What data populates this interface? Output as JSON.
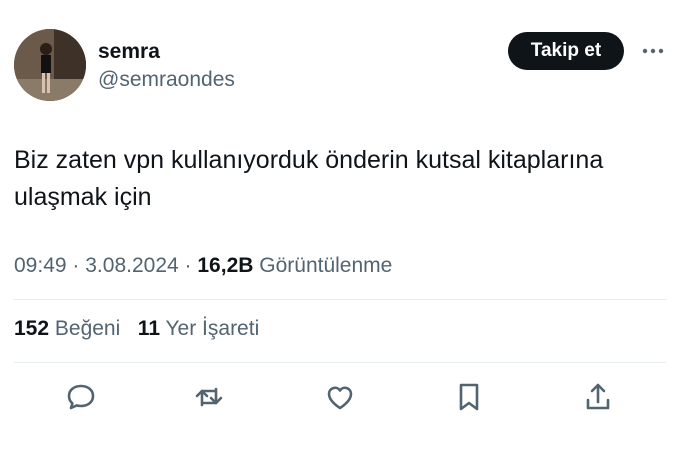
{
  "user": {
    "display_name": "semra",
    "handle": "@semraondes"
  },
  "header": {
    "follow_label": "Takip et",
    "more_icon": "more-horizontal-icon"
  },
  "tweet": {
    "text": "Biz zaten vpn kullanıyorduk önderin kutsal kitaplarına ulaşmak için",
    "time": "09:49",
    "separator": "·",
    "date": "3.08.2024",
    "views_count": "16,2B",
    "views_label": "Görüntülenme"
  },
  "stats": {
    "likes_count": "152",
    "likes_label": "Beğeni",
    "bookmarks_count": "11",
    "bookmarks_label": "Yer İşareti"
  },
  "actions": [
    "reply-icon",
    "retweet-icon",
    "like-icon",
    "bookmark-icon",
    "share-icon"
  ],
  "colors": {
    "text_primary": "#0f1419",
    "text_secondary": "#536471",
    "button_bg": "#0f1419",
    "divider": "#e6ecf0",
    "icon": "#536471"
  }
}
